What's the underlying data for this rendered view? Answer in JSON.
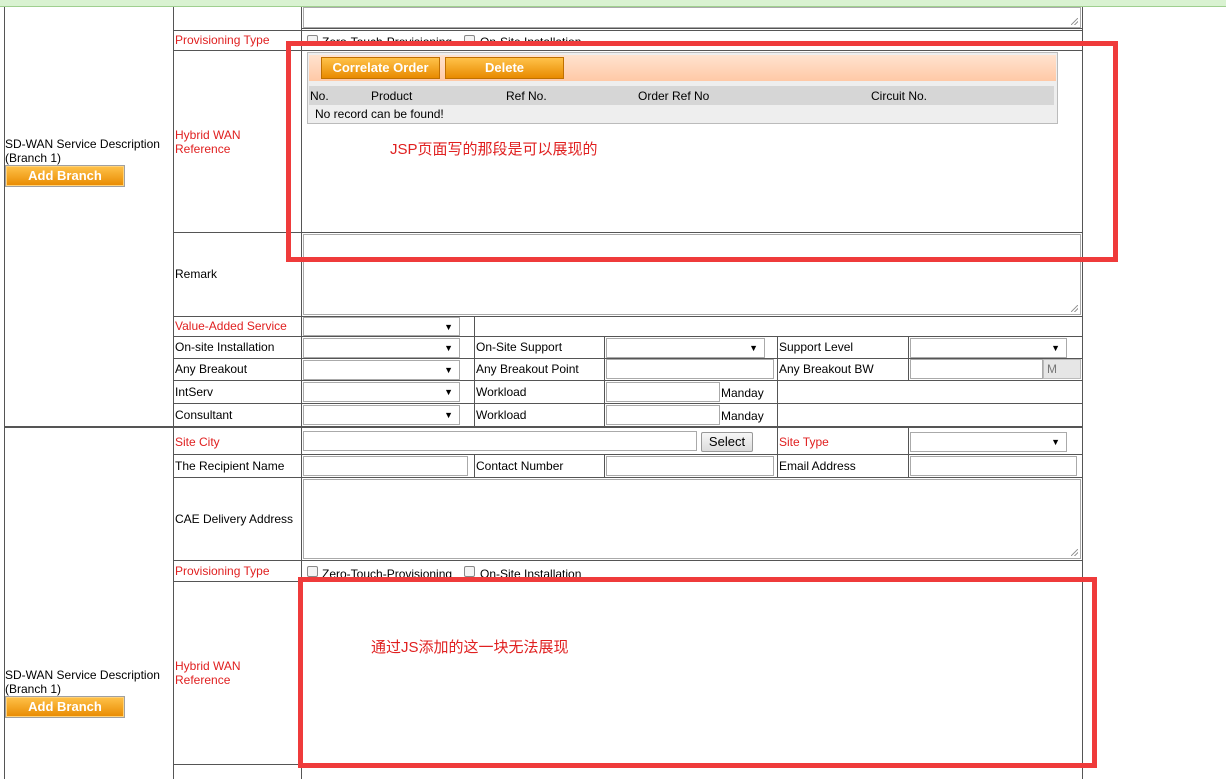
{
  "branch1": {
    "provisioning_label": "Provisioning Type",
    "provisioning_options": [
      "Zero-Touch-Provisioning",
      "On-Site Installation"
    ],
    "section_title": "SD-WAN Service Description",
    "section_subtitle": "(Branch 1)",
    "add_branch_label": "Add Branch",
    "hybrid_wan_label": [
      "Hybrid WAN",
      "Reference"
    ],
    "grid": {
      "correlate_label": "Correlate Order",
      "delete_label": "Delete",
      "columns": [
        "No.",
        "Product",
        "Ref No.",
        "Order Ref No",
        "Circuit No."
      ],
      "empty_text": "No record can be found!"
    },
    "remark_label": "Remark",
    "value_added_label": "Value-Added Service",
    "rows": {
      "onsite_installation": "On-site Installation",
      "onsite_support": "On-Site Support",
      "support_level": "Support Level",
      "any_breakout": "Any Breakout",
      "any_breakout_point": "Any Breakout Point",
      "any_breakout_bw": "Any Breakout BW",
      "bw_unit": "M",
      "intserv": "IntServ",
      "workload": "Workload",
      "manday": "Manday",
      "consultant": "Consultant"
    }
  },
  "branch2": {
    "site_city_label": "Site City",
    "select_label": "Select",
    "site_type_label": "Site Type",
    "recipient_label": "The Recipient Name",
    "contact_label": "Contact Number",
    "email_label": "Email Address",
    "cae_label": "CAE Delivery Address",
    "provisioning_label": "Provisioning Type",
    "provisioning_options": [
      "Zero-Touch-Provisioning",
      "On-Site Installation"
    ],
    "section_title": "SD-WAN Service Description",
    "section_subtitle": "(Branch 1)",
    "add_branch_label": "Add Branch",
    "hybrid_wan_label": [
      "Hybrid WAN",
      "Reference"
    ]
  },
  "annotations": {
    "top_note": "JSP页面写的那段是可以展现的",
    "bottom_note": "通过JS添加的这一块无法展现"
  },
  "colors": {
    "required_label": "#e02020",
    "annotation_red": "#ef3b3b",
    "button_orange": "#f0a020"
  },
  "icons": [
    "dropdown-arrow-icon",
    "resize-grip-icon",
    "checkbox-icon"
  ]
}
